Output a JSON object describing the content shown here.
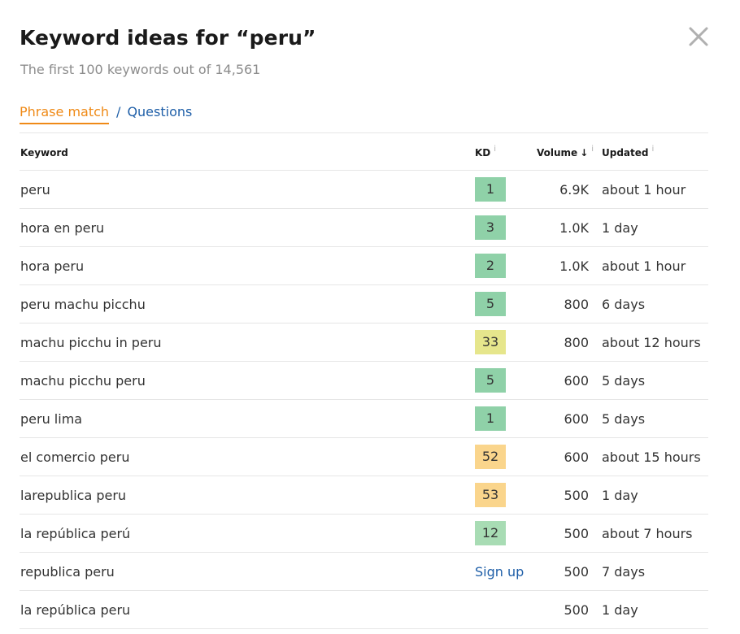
{
  "header": {
    "title": "Keyword ideas for “peru”",
    "subtitle": "The first 100 keywords out of 14,561",
    "close_icon": "close-icon"
  },
  "tabs": {
    "active": "Phrase match",
    "separator": "/",
    "other": "Questions"
  },
  "table": {
    "columns": {
      "keyword": "Keyword",
      "kd": "KD",
      "volume": "Volume",
      "volume_sort": "↓",
      "updated": "Updated",
      "info": "i"
    },
    "colors": {
      "kd_easy": "#8fd1a8",
      "kd_easy_light": "#a8dcb4",
      "kd_medium": "#e6e68c",
      "kd_hard": "#fad58c",
      "accent": "#ef8a17",
      "link": "#1f5fa8"
    },
    "rows": [
      {
        "keyword": "peru",
        "kd": "1",
        "kd_color": "#8fd1a8",
        "volume": "6.9K",
        "updated": "about 1 hour"
      },
      {
        "keyword": "hora en peru",
        "kd": "3",
        "kd_color": "#8fd1a8",
        "volume": "1.0K",
        "updated": "1 day"
      },
      {
        "keyword": "hora peru",
        "kd": "2",
        "kd_color": "#8fd1a8",
        "volume": "1.0K",
        "updated": "about 1 hour"
      },
      {
        "keyword": "peru machu picchu",
        "kd": "5",
        "kd_color": "#8fd1a8",
        "volume": "800",
        "updated": "6 days"
      },
      {
        "keyword": "machu picchu in peru",
        "kd": "33",
        "kd_color": "#e6e68c",
        "volume": "800",
        "updated": "about 12 hours"
      },
      {
        "keyword": "machu picchu peru",
        "kd": "5",
        "kd_color": "#8fd1a8",
        "volume": "600",
        "updated": "5 days"
      },
      {
        "keyword": "peru lima",
        "kd": "1",
        "kd_color": "#8fd1a8",
        "volume": "600",
        "updated": "5 days"
      },
      {
        "keyword": "el comercio peru",
        "kd": "52",
        "kd_color": "#fad58c",
        "volume": "600",
        "updated": "about 15 hours"
      },
      {
        "keyword": "larepublica peru",
        "kd": "53",
        "kd_color": "#fad58c",
        "volume": "500",
        "updated": "1 day"
      },
      {
        "keyword": "la república perú",
        "kd": "12",
        "kd_color": "#a8dcb4",
        "volume": "500",
        "updated": "about 7 hours"
      },
      {
        "keyword": "republica peru",
        "kd": "",
        "kd_color": "",
        "kd_signup": "Sign up",
        "volume": "500",
        "updated": "7 days"
      },
      {
        "keyword": "la república peru",
        "kd": "",
        "kd_color": "",
        "volume": "500",
        "updated": "1 day"
      }
    ]
  }
}
